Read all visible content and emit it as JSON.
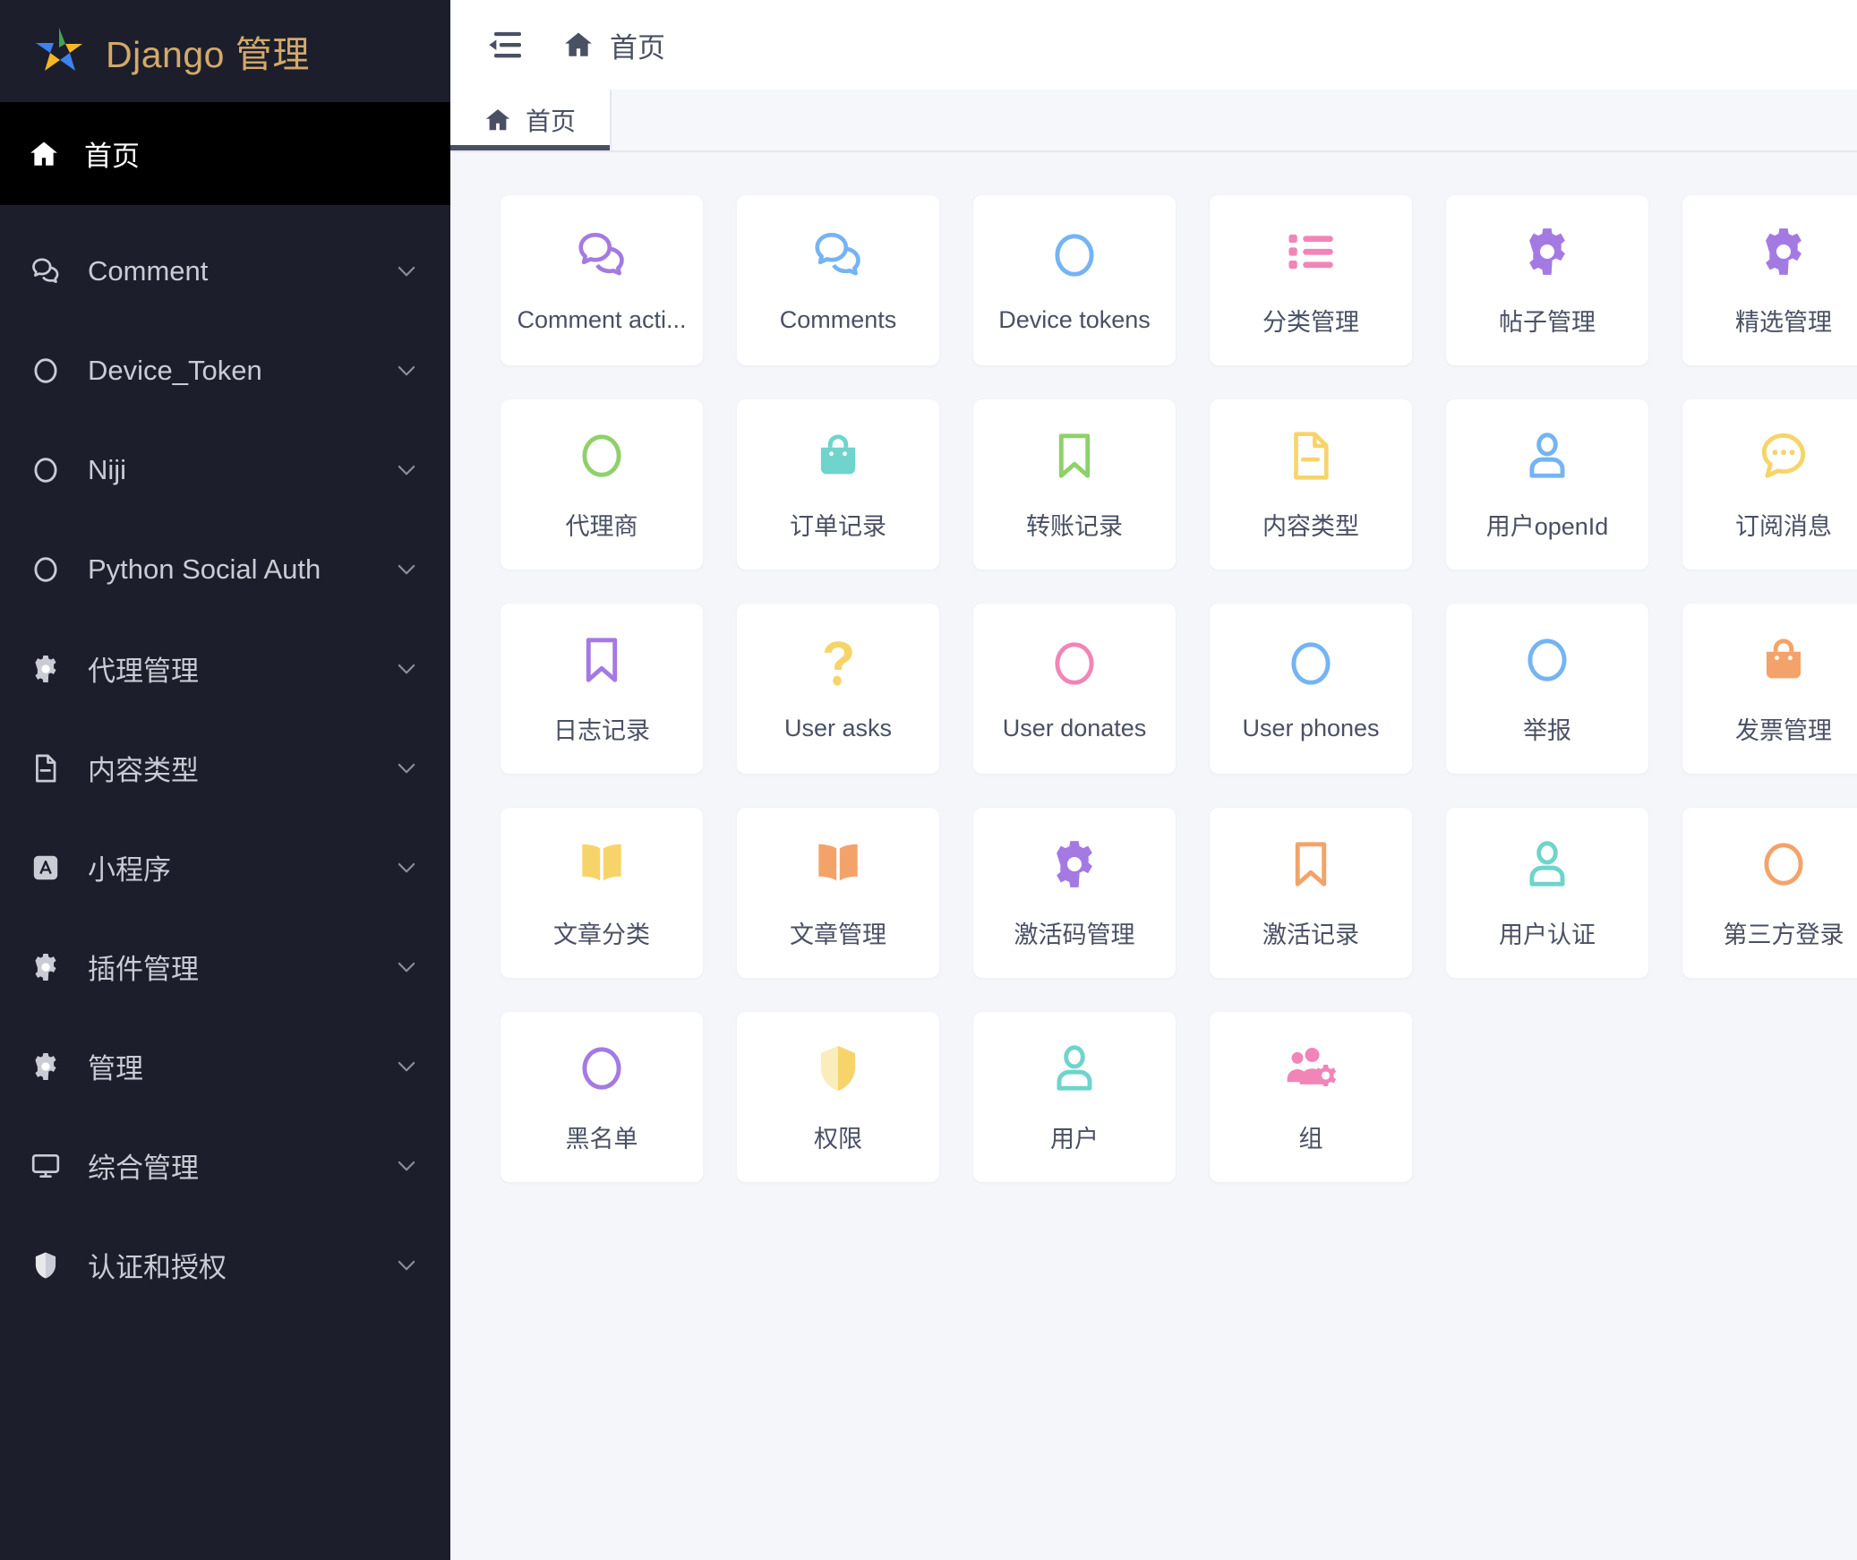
{
  "brand": {
    "title": "Django 管理",
    "logo_icon": "django-star-logo"
  },
  "sidebar": {
    "home": {
      "label": "首页",
      "icon": "home-icon",
      "active": true
    },
    "items": [
      {
        "label": "Comment",
        "icon": "chat-icon"
      },
      {
        "label": "Device_Token",
        "icon": "circle-icon"
      },
      {
        "label": "Niji",
        "icon": "circle-icon"
      },
      {
        "label": "Python Social Auth",
        "icon": "circle-icon"
      },
      {
        "label": "代理管理",
        "icon": "gear-icon"
      },
      {
        "label": "内容类型",
        "icon": "document-icon"
      },
      {
        "label": "小程序",
        "icon": "app-icon"
      },
      {
        "label": "插件管理",
        "icon": "gear-icon"
      },
      {
        "label": "管理",
        "icon": "gear-icon"
      },
      {
        "label": "综合管理",
        "icon": "monitor-icon"
      },
      {
        "label": "认证和授权",
        "icon": "shield-icon"
      }
    ],
    "chevron_icon": "chevron-down-icon"
  },
  "topbar": {
    "collapse_icon": "menu-collapse-icon",
    "breadcrumb": {
      "icon": "home-icon",
      "text": "首页"
    }
  },
  "tabs": [
    {
      "label": "首页",
      "icon": "home-icon",
      "active": true
    }
  ],
  "colors": {
    "sidebar_bg": "#1c1f2b",
    "sidebar_active_bg": "#000000",
    "brand_text": "#d4a96a",
    "content_bg": "#f4f6f9",
    "card_bg": "#ffffff",
    "text": "#4a5064",
    "purple": "#a47ae2",
    "blue": "#74b4f4",
    "pink": "#f285b8",
    "green": "#8ed16a",
    "teal": "#6fd4cb",
    "yellow": "#f7d46a",
    "orange": "#f3a36a"
  },
  "cards": [
    {
      "label": "Comment acti...",
      "icon": "chat-bubbles-icon",
      "color": "#a47ae2"
    },
    {
      "label": "Comments",
      "icon": "chat-bubbles-icon",
      "color": "#74b4f4"
    },
    {
      "label": "Device tokens",
      "icon": "circle-icon",
      "color": "#74b4f4"
    },
    {
      "label": "分类管理",
      "icon": "list-icon",
      "color": "#f285b8"
    },
    {
      "label": "帖子管理",
      "icon": "gear-icon",
      "color": "#a47ae2"
    },
    {
      "label": "精选管理",
      "icon": "gear-icon",
      "color": "#a47ae2"
    },
    {
      "label": "代理商",
      "icon": "circle-icon",
      "color": "#8ed16a"
    },
    {
      "label": "订单记录",
      "icon": "shopping-bag-icon",
      "color": "#6fd4cb"
    },
    {
      "label": "转账记录",
      "icon": "bookmark-icon",
      "color": "#8ed16a"
    },
    {
      "label": "内容类型",
      "icon": "document-icon",
      "color": "#f7d46a"
    },
    {
      "label": "用户openId",
      "icon": "user-icon",
      "color": "#74b4f4"
    },
    {
      "label": "订阅消息",
      "icon": "chat-dots-icon",
      "color": "#f7d46a"
    },
    {
      "label": "日志记录",
      "icon": "bookmark-icon",
      "color": "#a47ae2"
    },
    {
      "label": "User asks",
      "icon": "question-icon",
      "color": "#f7d46a"
    },
    {
      "label": "User donates",
      "icon": "circle-icon",
      "color": "#f285b8"
    },
    {
      "label": "User phones",
      "icon": "circle-icon",
      "color": "#74b4f4"
    },
    {
      "label": "举报",
      "icon": "circle-icon",
      "color": "#74b4f4"
    },
    {
      "label": "发票管理",
      "icon": "shopping-bag-icon",
      "color": "#f3a36a"
    },
    {
      "label": "文章分类",
      "icon": "book-icon",
      "color": "#f7d46a"
    },
    {
      "label": "文章管理",
      "icon": "book-icon",
      "color": "#f3a36a"
    },
    {
      "label": "激活码管理",
      "icon": "gear-icon",
      "color": "#a47ae2"
    },
    {
      "label": "激活记录",
      "icon": "bookmark-icon",
      "color": "#f3a36a"
    },
    {
      "label": "用户认证",
      "icon": "user-icon",
      "color": "#6fd4cb"
    },
    {
      "label": "第三方登录",
      "icon": "circle-icon",
      "color": "#f3a36a"
    },
    {
      "label": "黑名单",
      "icon": "circle-icon",
      "color": "#a47ae2"
    },
    {
      "label": "权限",
      "icon": "shield-icon",
      "color": "#f7d46a"
    },
    {
      "label": "用户",
      "icon": "user-icon",
      "color": "#6fd4cb"
    },
    {
      "label": "组",
      "icon": "group-icon",
      "color": "#f285b8"
    }
  ]
}
